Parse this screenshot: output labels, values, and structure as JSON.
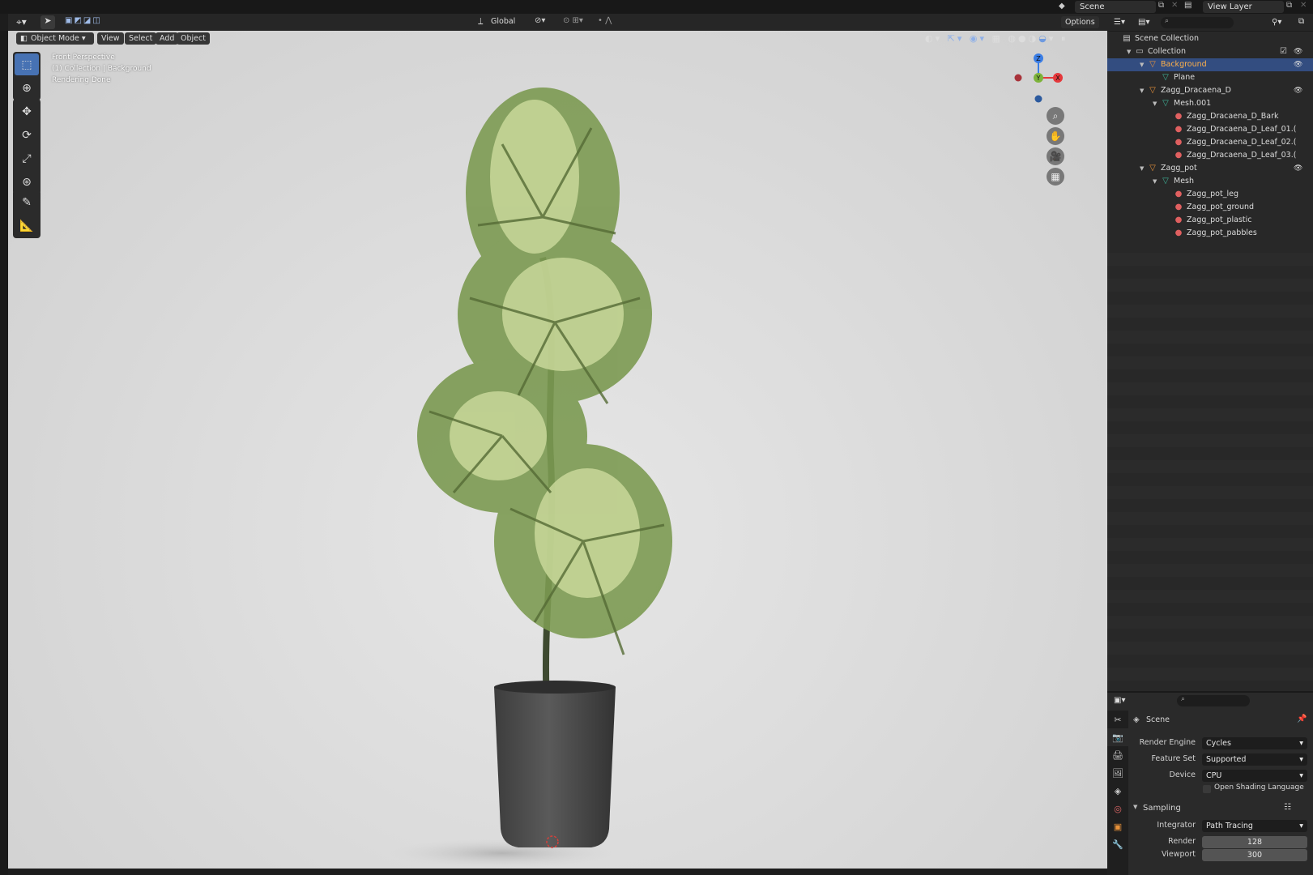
{
  "topbar": {
    "scene_label": "Scene",
    "view_layer_label": "View Layer"
  },
  "header3d": {
    "mode": "Object Mode",
    "menus": [
      "View",
      "Select",
      "Add",
      "Object"
    ],
    "transform_orientation": "Global",
    "options_label": "Options"
  },
  "viewport": {
    "info_lines": [
      "Front Perspective",
      "(1) Collection | Background",
      "Rendering Done"
    ],
    "gizmo_axes": {
      "z": "Z",
      "y": "Y",
      "x": "X"
    }
  },
  "outliner": {
    "rows": [
      {
        "label": "Scene Collection",
        "depth": 0,
        "icon": "scene-collection-icon",
        "selected": false,
        "visible_toggle": false
      },
      {
        "label": "Collection",
        "depth": 1,
        "icon": "collection-icon",
        "selected": false,
        "visible_toggle": true
      },
      {
        "label": "Background",
        "depth": 2,
        "icon": "object-icon",
        "selected": true,
        "visible_toggle": true
      },
      {
        "label": "Plane",
        "depth": 3,
        "icon": "mesh-icon",
        "selected": false,
        "visible_toggle": false
      },
      {
        "label": "Zagg_Dracaena_D",
        "depth": 2,
        "icon": "object-icon",
        "selected": false,
        "visible_toggle": true
      },
      {
        "label": "Mesh.001",
        "depth": 3,
        "icon": "mesh-icon",
        "selected": false,
        "visible_toggle": false
      },
      {
        "label": "Zagg_Dracaena_D_Bark",
        "depth": 4,
        "icon": "material-icon",
        "selected": false,
        "visible_toggle": false
      },
      {
        "label": "Zagg_Dracaena_D_Leaf_01.(",
        "depth": 4,
        "icon": "material-icon",
        "selected": false,
        "visible_toggle": false
      },
      {
        "label": "Zagg_Dracaena_D_Leaf_02.(",
        "depth": 4,
        "icon": "material-icon",
        "selected": false,
        "visible_toggle": false
      },
      {
        "label": "Zagg_Dracaena_D_Leaf_03.(",
        "depth": 4,
        "icon": "material-icon",
        "selected": false,
        "visible_toggle": false
      },
      {
        "label": "Zagg_pot",
        "depth": 2,
        "icon": "object-icon",
        "selected": false,
        "visible_toggle": true
      },
      {
        "label": "Mesh",
        "depth": 3,
        "icon": "mesh-icon",
        "selected": false,
        "visible_toggle": false
      },
      {
        "label": "Zagg_pot_leg",
        "depth": 4,
        "icon": "material-icon",
        "selected": false,
        "visible_toggle": false
      },
      {
        "label": "Zagg_pot_ground",
        "depth": 4,
        "icon": "material-icon",
        "selected": false,
        "visible_toggle": false
      },
      {
        "label": "Zagg_pot_plastic",
        "depth": 4,
        "icon": "material-icon",
        "selected": false,
        "visible_toggle": false
      },
      {
        "label": "Zagg_pot_pabbles",
        "depth": 4,
        "icon": "material-icon",
        "selected": false,
        "visible_toggle": false
      }
    ]
  },
  "properties": {
    "context": "Scene",
    "render_engine_label": "Render Engine",
    "render_engine": "Cycles",
    "feature_set_label": "Feature Set",
    "feature_set": "Supported",
    "device_label": "Device",
    "device": "CPU",
    "osl_label": "Open Shading Language",
    "sampling_label": "Sampling",
    "integrator_label": "Integrator",
    "integrator": "Path Tracing",
    "render_label": "Render",
    "render_samples": "128",
    "viewport_label": "Viewport",
    "viewport_samples": "300"
  },
  "colors": {
    "accent": "#4772b3",
    "selection": "#334d80",
    "object_icon": "#e8923a",
    "mesh_icon": "#3fb59a",
    "material_icon": "#e06060",
    "axis_x": "#e5383b",
    "axis_y": "#7db33a",
    "axis_z": "#3a7de5"
  }
}
